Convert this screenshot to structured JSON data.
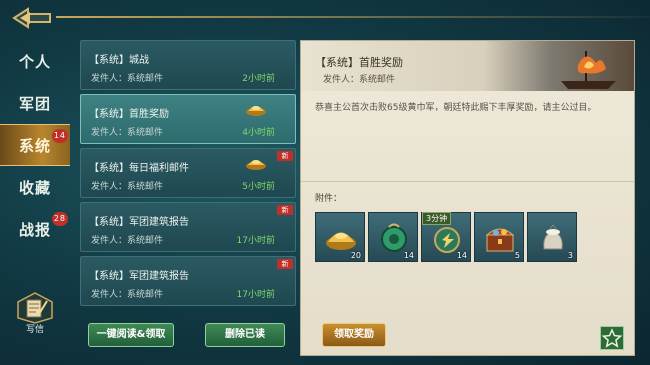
{
  "sidebar": {
    "items": [
      {
        "label": "个人",
        "badge": ""
      },
      {
        "label": "军团",
        "badge": ""
      },
      {
        "label": "系统",
        "badge": "14"
      },
      {
        "label": "收藏",
        "badge": ""
      },
      {
        "label": "战报",
        "badge": "28"
      }
    ],
    "write_label": "写信"
  },
  "mail_list": [
    {
      "title": "【系统】城战",
      "sender": "发件人：系统邮件",
      "time": "2小时前",
      "new": "",
      "has_attachment": false
    },
    {
      "title": "【系统】首胜奖励",
      "sender": "发件人：系统邮件",
      "time": "4小时前",
      "new": "",
      "has_attachment": true
    },
    {
      "title": "【系统】每日福利邮件",
      "sender": "发件人：系统邮件",
      "time": "5小时前",
      "new": "新",
      "has_attachment": true
    },
    {
      "title": "【系统】军团建筑报告",
      "sender": "发件人：系统邮件",
      "time": "17小时前",
      "new": "新",
      "has_attachment": false
    },
    {
      "title": "【系统】军团建筑报告",
      "sender": "发件人：系统邮件",
      "time": "17小时前",
      "new": "新",
      "has_attachment": false
    }
  ],
  "buttons": {
    "read_all": "一键阅读&领取",
    "delete_read": "删除已读",
    "claim": "领取奖励"
  },
  "detail": {
    "title": "【系统】首胜奖励",
    "sender": "发件人：系统邮件",
    "body": "恭喜主公首次击败65级黄巾军，朝廷特此赐下丰厚奖励，请主公过目。",
    "attachments_label": "附件：",
    "attachments": [
      {
        "icon": "gold-ingot-icon",
        "count": "20",
        "tag": ""
      },
      {
        "icon": "jade-token-icon",
        "count": "14",
        "tag": ""
      },
      {
        "icon": "speedup-icon",
        "count": "14",
        "tag": "3分钟"
      },
      {
        "icon": "treasure-chest-icon",
        "count": "5",
        "tag": ""
      },
      {
        "icon": "rice-sack-icon",
        "count": "3",
        "tag": ""
      }
    ]
  },
  "colors": {
    "accent": "#c9a75a",
    "time": "#7fd86a",
    "badge": "#c0302a"
  }
}
